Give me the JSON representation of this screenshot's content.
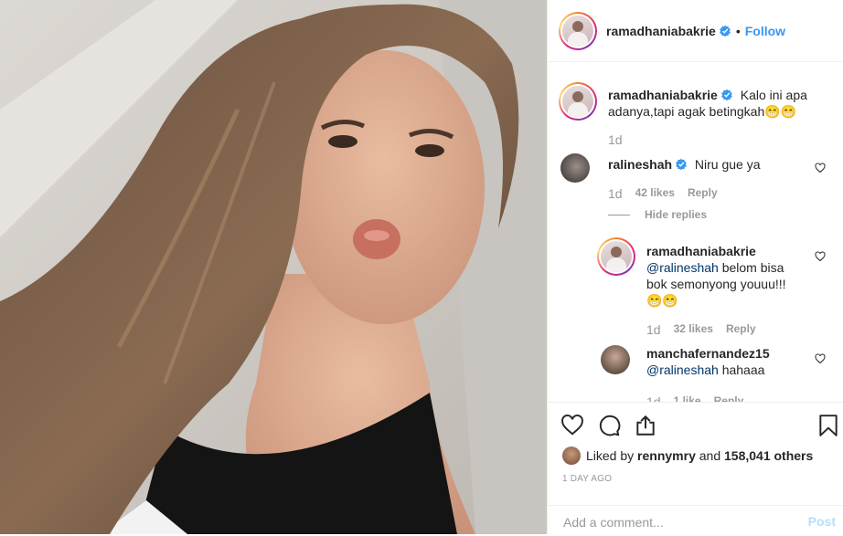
{
  "header": {
    "username": "ramadhaniabakrie",
    "follow_label": "Follow"
  },
  "caption": {
    "username": "ramadhaniabakrie",
    "text": "Kalo ini apa adanya,tapi agak betingkah😁😁",
    "time": "1d"
  },
  "comments": [
    {
      "username": "ralineshah",
      "text": "Niru gue ya",
      "time": "1d",
      "likes": "42 likes",
      "reply_label": "Reply",
      "hide_replies_label": "Hide replies"
    }
  ],
  "replies": [
    {
      "username": "ramadhaniabakrie",
      "mention": "@ralineshah",
      "text": "belom bisa bok semonyong youuu!!! 😁😁",
      "time": "1d",
      "likes": "32 likes",
      "reply_label": "Reply"
    },
    {
      "username": "manchafernandez15",
      "mention": "@ralineshah",
      "text": "hahaaa",
      "time": "1d",
      "likes": "1 like",
      "reply_label": "Reply"
    }
  ],
  "post_meta": {
    "liked_by_prefix": "Liked by",
    "liked_by_user": "rennymry",
    "and_label": "and",
    "others_count": "158,041 others",
    "time_ago": "1 DAY AGO"
  },
  "add_comment": {
    "placeholder": "Add a comment...",
    "post_label": "Post"
  },
  "colors": {
    "link_blue": "#3897f0",
    "mention_blue": "#003569",
    "muted": "#999999"
  },
  "icons": {
    "verified": "verified-badge-icon",
    "like": "heart-icon",
    "comment": "comment-icon",
    "share": "share-icon",
    "save": "bookmark-icon"
  }
}
